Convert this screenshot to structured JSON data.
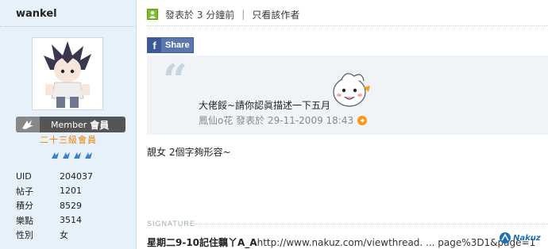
{
  "user": {
    "name": "wankel",
    "badge_label": "Member",
    "badge_cn": "會員",
    "level": "二十三級會員",
    "stats": [
      {
        "label": "UID",
        "value": "204037"
      },
      {
        "label": "帖子",
        "value": "1201"
      },
      {
        "label": "積分",
        "value": "8529"
      },
      {
        "label": "樂點",
        "value": "3514"
      },
      {
        "label": "性別",
        "value": "女"
      }
    ]
  },
  "post": {
    "posted": "發表於 3 分鐘前",
    "separator": "|",
    "author_only": "只看該作者",
    "share": "Share",
    "share_f": "f",
    "quote": {
      "text": "大佬餒~請你認眞描述一下五月",
      "meta": "鳳仙o花 發表於 29-11-2009 18:43"
    },
    "body": "靚女 2個字夠形容~",
    "signature_label": "SIGNATURE",
    "signature_bold": "星期二9-10記住黐丫A_A",
    "signature_link": "http://www.nakuz.com/viewthread. ... page%3D1&page=1"
  },
  "watermark": "Nakuz",
  "colors": {
    "sidebar_bg": "#e6f1fa",
    "level_orange": "#f08000",
    "facebook_blue": "#3b5998",
    "quote_bg": "#f1f4f7"
  }
}
